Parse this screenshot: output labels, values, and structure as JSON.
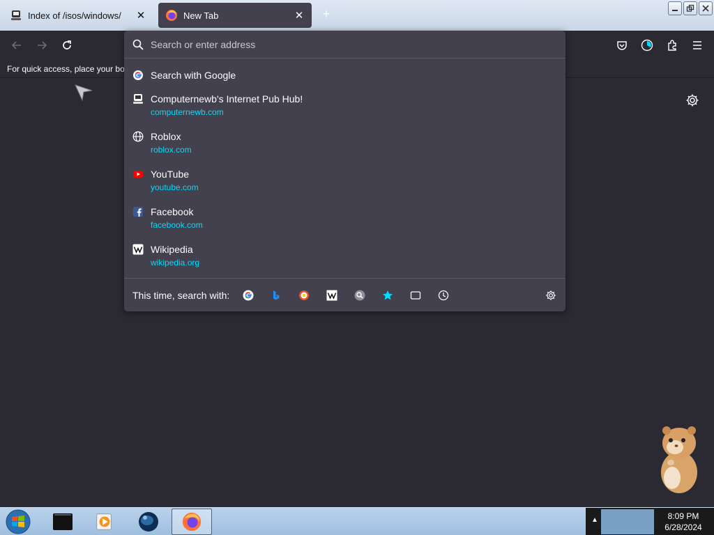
{
  "tabs": [
    {
      "title": "Index of /isos/windows/",
      "favicon": "server-icon",
      "active": false
    },
    {
      "title": "New Tab",
      "favicon": "firefox-icon",
      "active": true
    }
  ],
  "new_tab_symbol": "+",
  "toolbar": {
    "back": "back-arrow-icon",
    "forward": "forward-arrow-icon",
    "reload": "reload-icon",
    "right_icons": [
      "pocket-icon",
      "account-icon",
      "extensions-icon",
      "menu-icon"
    ]
  },
  "bookmarks_bar": {
    "text": "For quick access, place your bookmarks here on the bookmarks toolbar."
  },
  "urlbar": {
    "placeholder": "Search or enter address",
    "search_suggestion": "Search with Google",
    "results": [
      {
        "title": "Computernewb's Internet Pub Hub!",
        "url": "computernewb.com",
        "icon": "computernewb-icon"
      },
      {
        "title": "Roblox",
        "url": "roblox.com",
        "icon": "globe-icon"
      },
      {
        "title": "YouTube",
        "url": "youtube.com",
        "icon": "youtube-icon"
      },
      {
        "title": "Facebook",
        "url": "facebook.com",
        "icon": "facebook-icon"
      },
      {
        "title": "Wikipedia",
        "url": "wikipedia.org",
        "icon": "wikipedia-icon"
      }
    ],
    "oneoff_label": "This time, search with:",
    "oneoff_engines": [
      "google-icon",
      "bing-icon",
      "duckduckgo-icon",
      "wikipedia-icon",
      "search-engine-icon",
      "bookmarks-star-icon",
      "tabs-icon",
      "history-icon"
    ]
  },
  "taskbar": {
    "time": "8:09 PM",
    "date": "6/28/2024",
    "apps": [
      "terminal-icon",
      "media-player-icon",
      "globe-browser-icon",
      "firefox-icon"
    ]
  },
  "colors": {
    "accent_url": "#00ddff",
    "panel": "#42414d",
    "background": "#2b2a33"
  }
}
